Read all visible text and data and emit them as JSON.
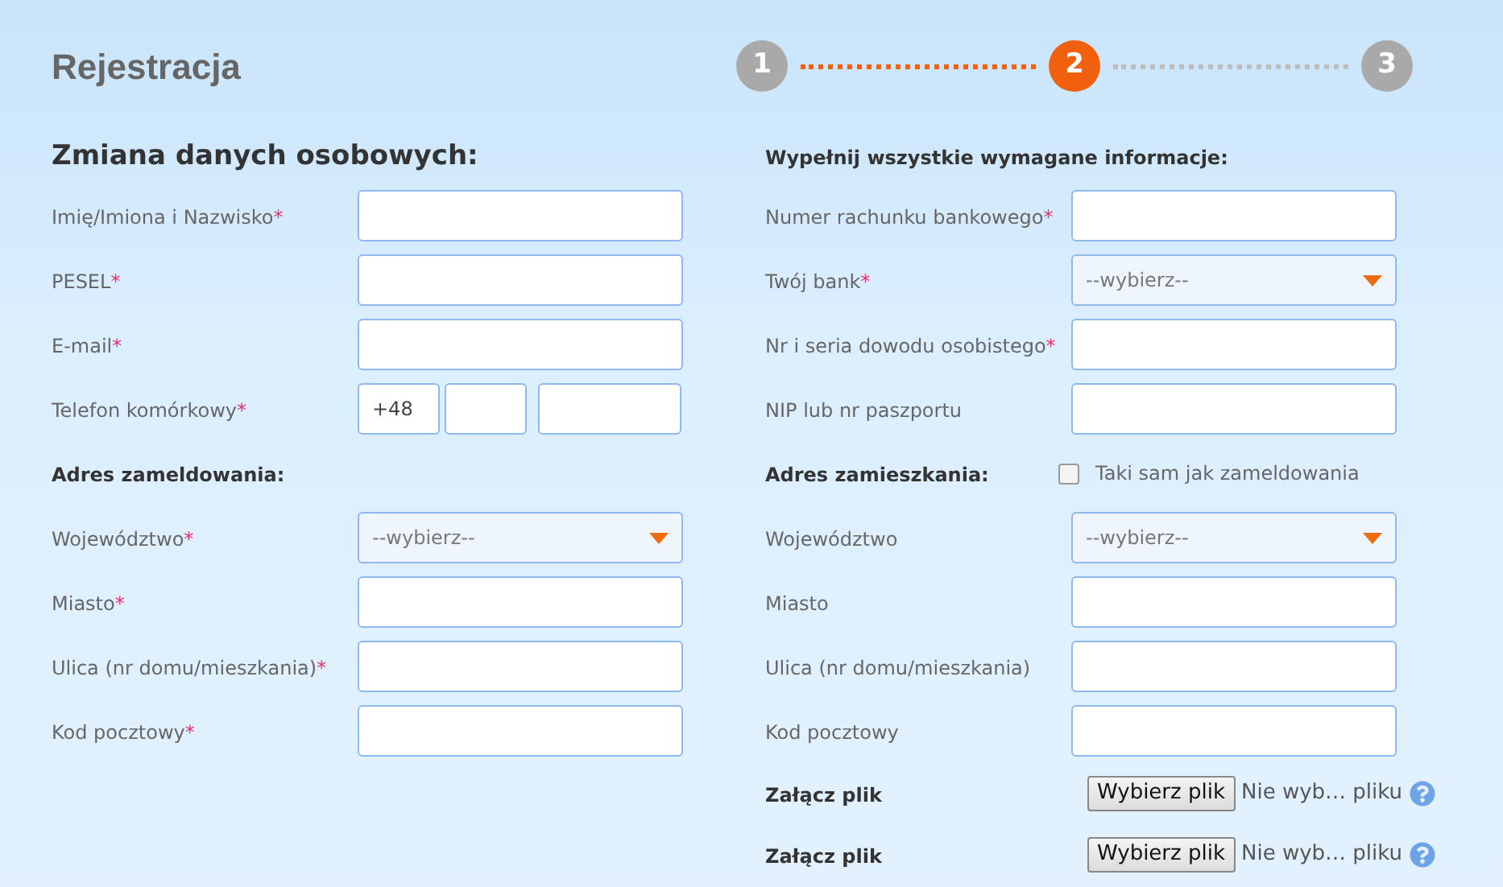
{
  "title": "Rejestracja",
  "steps": [
    {
      "label": "1",
      "selected": false
    },
    {
      "label": "2",
      "selected": true
    },
    {
      "label": "3",
      "selected": false
    }
  ],
  "left": {
    "heading": "Zmiana danych osobowych:",
    "rows": [
      {
        "kind": "text",
        "label": "Imię/Imiona i Nazwisko",
        "mark": "*"
      },
      {
        "kind": "text",
        "label": "PESEL",
        "mark": "*"
      },
      {
        "kind": "text",
        "label": "E-mail",
        "mark": "*"
      },
      {
        "kind": "phone",
        "label": "Telefon komórkowy",
        "mark": "*",
        "prefix": "+48"
      },
      {
        "kind": "section",
        "label": "Adres zameldowania:"
      },
      {
        "kind": "select",
        "label": "Województwo",
        "mark": "*",
        "value": "--wybierz--"
      },
      {
        "kind": "text",
        "label": "Miasto",
        "mark": "*"
      },
      {
        "kind": "text",
        "label": "Ulica (nr domu/mieszkania)",
        "mark": "*"
      },
      {
        "kind": "text",
        "label": "Kod pocztowy",
        "mark": "*"
      }
    ]
  },
  "right": {
    "heading": "Wypełnij wszystkie wymagane informacje:",
    "rows": [
      {
        "kind": "text",
        "label": "Numer rachunku bankowego",
        "mark": "*"
      },
      {
        "kind": "select",
        "label": "Twój bank",
        "mark": "*",
        "value": "--wybierz--"
      },
      {
        "kind": "text",
        "label": "Nr i seria dowodu osobistego",
        "mark": "*"
      },
      {
        "kind": "text",
        "label": "NIP lub nr paszportu"
      },
      {
        "kind": "section",
        "label": "Adres zamieszkania:",
        "checkbox": {
          "label": "Taki sam jak zameldowania",
          "checked": false
        }
      },
      {
        "kind": "select",
        "label": "Województwo",
        "value": "--wybierz--"
      },
      {
        "kind": "text",
        "label": "Miasto"
      },
      {
        "kind": "text",
        "label": "Ulica (nr domu/mieszkania)"
      },
      {
        "kind": "text",
        "label": "Kod pocztowy"
      },
      {
        "kind": "file",
        "label": "Załącz plik",
        "button": "Wybierz plik",
        "status": "Nie wyb… pliku"
      },
      {
        "kind": "file",
        "label": "Załącz plik",
        "button": "Wybierz plik",
        "status": "Nie wyb… pliku"
      }
    ]
  }
}
